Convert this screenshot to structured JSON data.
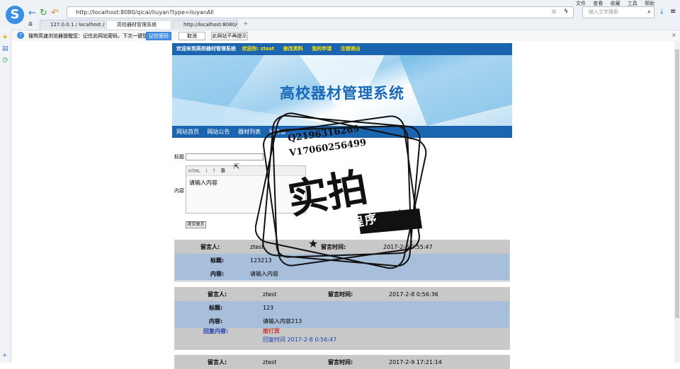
{
  "browser": {
    "logo": "S",
    "url": "http://localhost:8080/qicai/liuyan?type=liuyanAll",
    "top_menu": [
      "文件",
      "查看",
      "收藏",
      "工具",
      "帮助"
    ],
    "search_placeholder": "输入文字搜索",
    "tabs": [
      {
        "label": "127.0.0.1 / localhost /"
      },
      {
        "label": "高校器材管理系统"
      },
      {
        "label": "http://localhost:8080/c"
      }
    ],
    "notice": {
      "text": "搜狗高速浏览器提醒您：记住此网站密码，下次一键登录！",
      "remember_label": "记住密码",
      "cancel_label": "取消",
      "never_label": "此网站不再提示"
    }
  },
  "header": {
    "welcome_site": "欢迎来到高校器材管理系统",
    "welcome_user": "欢迎你: ztest",
    "edit_profile": "修改资料",
    "my_apply": "我的申请",
    "logout": "注销退出"
  },
  "banner": {
    "title": "高校器材管理系统"
  },
  "nav": [
    "网站首页",
    "网站公告",
    "器材列表",
    "留言板"
  ],
  "form": {
    "title_label": "标题",
    "content_label": "内容",
    "editor_toolbar": [
      "HTML",
      "I",
      "T",
      "B"
    ],
    "editor_placeholder": "请输入内容",
    "submit_label": "提交留言"
  },
  "messages": [
    {
      "author_label": "留言人:",
      "author": "ztest",
      "time_label": "留言时间:",
      "time": "2017-2-8 0:55:47",
      "title_label": "标题:",
      "title": "123213",
      "content_label": "内容:",
      "content": "请输入内容"
    },
    {
      "author_label": "留言人:",
      "author": "ztest",
      "time_label": "留言时间:",
      "time": "2017-2-8 0:56:36",
      "title_label": "标题:",
      "title": "123",
      "content_label": "内容:",
      "content": "请输入内容213",
      "reply_label": "回复内容:",
      "reply": "撤打算",
      "reply_time": "回复时间 2017-2-8 0:56:47"
    },
    {
      "author_label": "留言人:",
      "author": "ztest",
      "time_label": "留言时间:",
      "time": "2017-2-9 17:21:14"
    }
  ],
  "watermark": {
    "qq": "Q2196316269",
    "wechat": "V17060256499",
    "big": "实拍",
    "sub": "全微程序"
  }
}
